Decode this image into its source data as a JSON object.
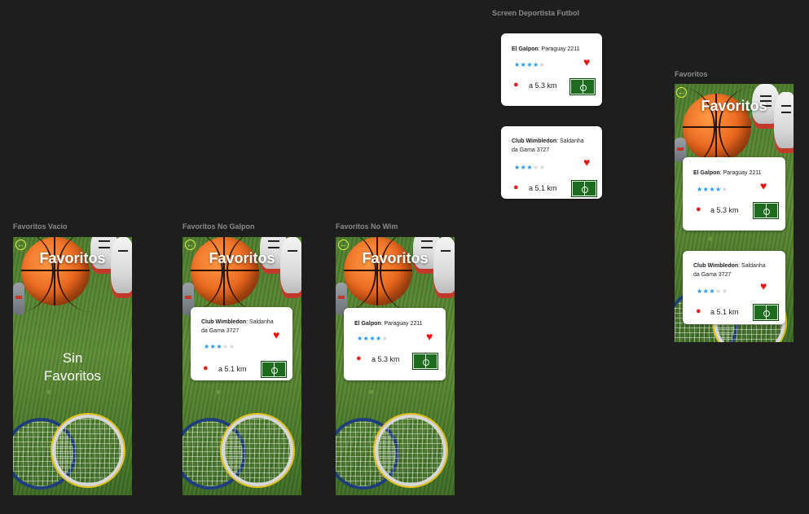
{
  "frames": {
    "deportista": "Screen Deportista Futbol",
    "favoritos": "Favoritos",
    "vacio": "Favoritos Vacio",
    "no_galpon": "Favoritos No Galpon",
    "no_wim": "Favoritos No Wim"
  },
  "screen": {
    "title": "Favoritos",
    "back_icon": "arrow-left-circle-icon",
    "empty_line1": "Sin",
    "empty_line2": "Favoritos"
  },
  "clubs": {
    "galpon": {
      "name": "El Galpon",
      "address": ": Paraguay 2211",
      "rating": 4.5,
      "distance": "a 5.3 km"
    },
    "wimbledon": {
      "name": "Club Wimbledon",
      "address": ": Saldanha da Gama 3727",
      "rating": 3,
      "distance": "a 5.1 km"
    }
  },
  "colors": {
    "background": "#1e1e1e",
    "heart": "#e11111",
    "star": "#2196f3",
    "back_icon": "#e7f04a"
  }
}
